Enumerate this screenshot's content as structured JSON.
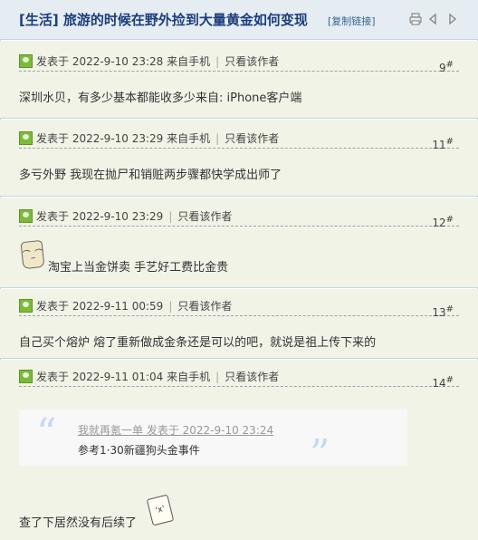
{
  "thread": {
    "title": "[生活] 旅游的时候在野外捡到大量黄金如何变现",
    "copy_link": "[复制链接]"
  },
  "header_icons": [
    "printer-icon",
    "prev-arrow-icon",
    "next-arrow-icon"
  ],
  "posts": [
    {
      "meta": "发表于 2022-9-10 23:28 来自手机",
      "only_author": "只看该作者",
      "floor": "9",
      "floor_mark": "#",
      "content": "深圳水贝，有多少基本都能收多少来自: iPhone客户端"
    },
    {
      "meta": "发表于 2022-9-10 23:29 来自手机",
      "only_author": "只看该作者",
      "floor": "11",
      "floor_mark": "#",
      "content": "多亏外野 我现在抛尸和销赃两步骤都快学成出师了"
    },
    {
      "meta": "发表于 2022-9-10 23:29",
      "only_author": "只看该作者",
      "floor": "12",
      "floor_mark": "#",
      "content": "淘宝上当金饼卖 手艺好工费比金贵"
    },
    {
      "meta": "发表于 2022-9-11 00:59",
      "only_author": "只看该作者",
      "floor": "13",
      "floor_mark": "#",
      "content": "自己买个熔炉 熔了重新做成金条还是可以的吧，就说是祖上传下来的"
    },
    {
      "meta": "发表于 2022-9-11 01:04 来自手机",
      "only_author": "只看该作者",
      "floor": "14",
      "floor_mark": "#",
      "content": "查了下居然没有后续了"
    }
  ],
  "quote": {
    "meta": "我就再氪一单 发表于 2022-9-10 23:24",
    "text": "参考1·30新疆狗头金事件",
    "open_mark": "“",
    "close_mark": "”"
  }
}
